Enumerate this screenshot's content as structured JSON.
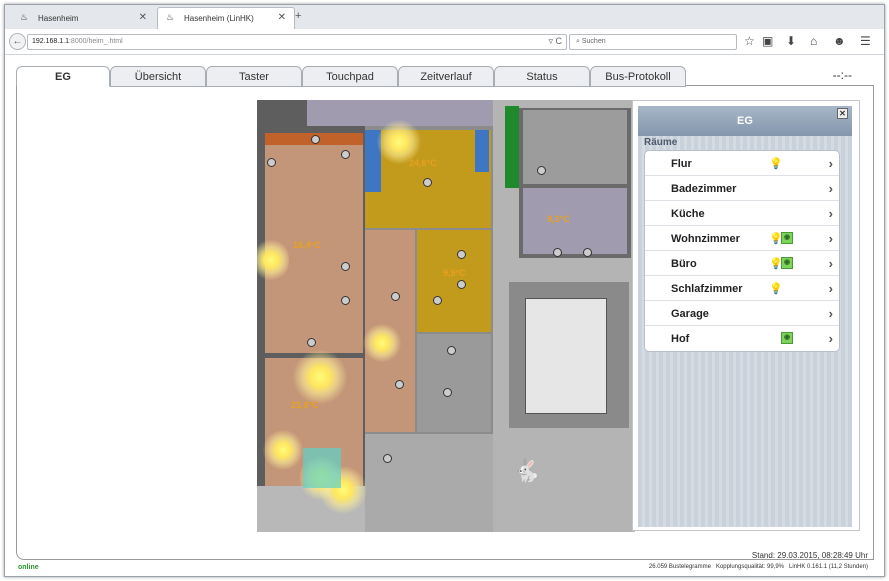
{
  "browser": {
    "tabs": [
      {
        "label": "Hasenheim",
        "active": false
      },
      {
        "label": "Hasenheim (LinHK)",
        "active": true
      }
    ],
    "url_host": "192.168.1.1",
    "url_rest": ":8000/heim_.html",
    "search_placeholder": "Suchen"
  },
  "app": {
    "tabs": [
      "EG",
      "Übersicht",
      "Taster",
      "Touchpad",
      "Zeitverlauf",
      "Status",
      "Bus-Protokoll"
    ],
    "active_tab": "EG",
    "clock": "--:--"
  },
  "floorplan": {
    "temps": [
      "24,6°C",
      "16,4°C",
      "9,9°C",
      "21,9°C",
      "9,3°C"
    ]
  },
  "panel": {
    "title": "EG",
    "close_symbol": "☒",
    "section": "Räume",
    "rooms": [
      {
        "name": "Flur",
        "light": true,
        "sensor": false
      },
      {
        "name": "Badezimmer",
        "light": false,
        "sensor": false
      },
      {
        "name": "Küche",
        "light": false,
        "sensor": false
      },
      {
        "name": "Wohnzimmer",
        "light": true,
        "sensor": true
      },
      {
        "name": "Büro",
        "light": true,
        "sensor": true
      },
      {
        "name": "Schlafzimmer",
        "light": true,
        "sensor": false
      },
      {
        "name": "Garage",
        "light": false,
        "sensor": false
      },
      {
        "name": "Hof",
        "light": false,
        "sensor": true
      }
    ]
  },
  "status": {
    "online": "online",
    "stand": "Stand: 29.03.2015, 08:28:49 Uhr",
    "telegrams": "26.059 Bustelegramme",
    "quality": "Kopplungsqualität: 99,9%",
    "version": "LinHK 0.161.1 (11,2 Stunden)"
  },
  "colors": {
    "accent": "#8396ac",
    "online": "#2a9a2a",
    "temp": "#e8a020",
    "sensor_on": "#7dd35c",
    "light_on": "#e8cc10"
  }
}
